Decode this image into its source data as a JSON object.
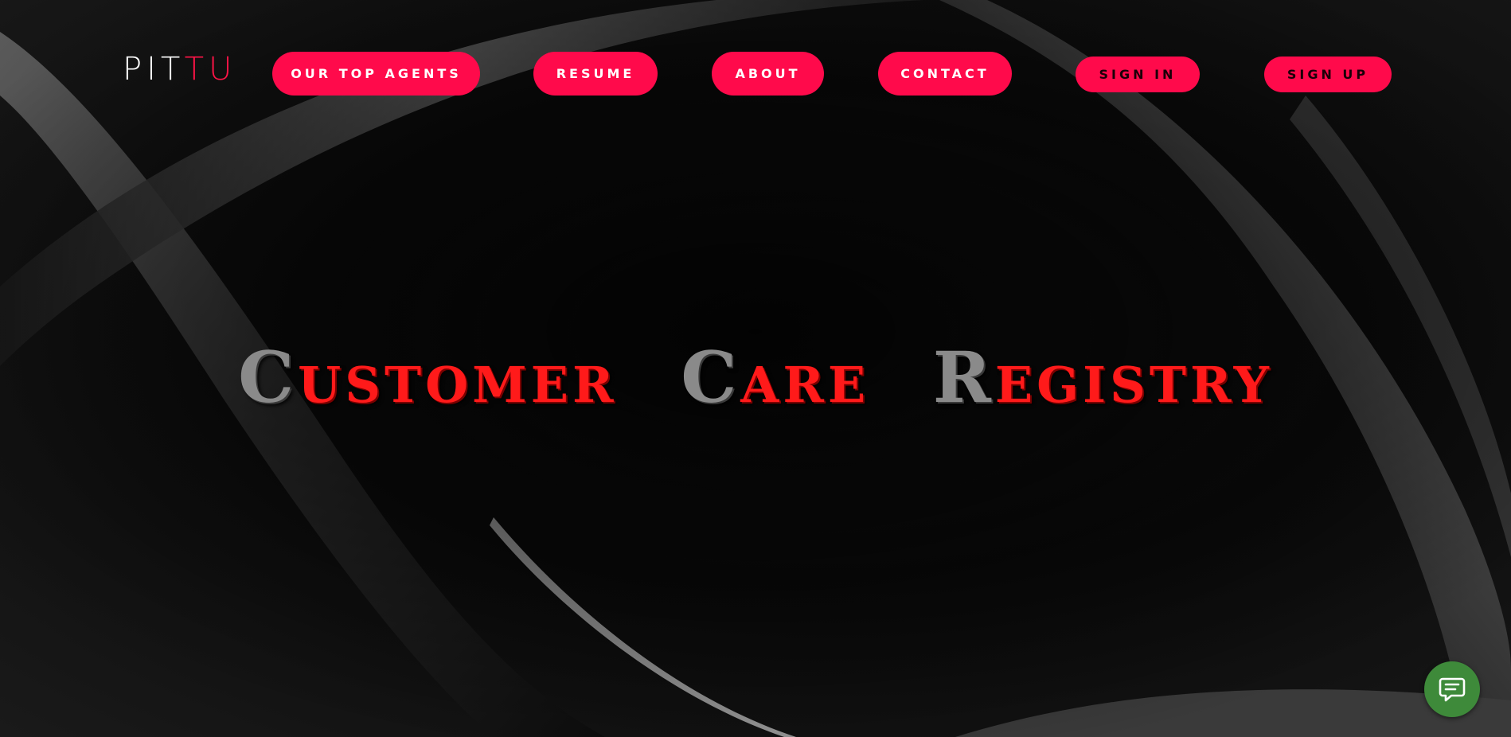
{
  "brand": {
    "logo_part1": "PIT",
    "logo_part2": "TU",
    "accent_color": "#ff0a4b"
  },
  "nav": {
    "items": [
      {
        "label": "OUR TOP AGENTS"
      },
      {
        "label": "RESUME"
      },
      {
        "label": "ABOUT"
      },
      {
        "label": "CONTACT"
      }
    ],
    "sign_in": "SIGN IN",
    "sign_up": "SIGN UP"
  },
  "hero": {
    "words": [
      {
        "first": "C",
        "rest": "ustomer"
      },
      {
        "first": "C",
        "rest": "are"
      },
      {
        "first": "R",
        "rest": "egistry"
      }
    ]
  },
  "chat": {
    "icon": "chat-icon",
    "color": "#3e8a3a"
  }
}
